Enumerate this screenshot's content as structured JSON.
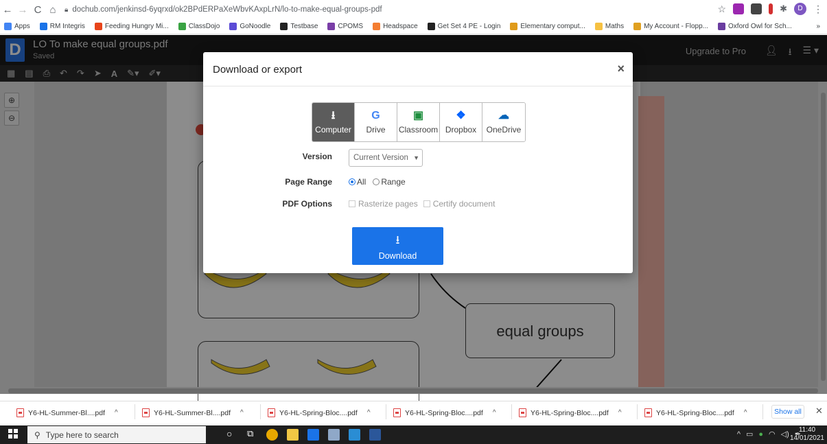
{
  "browser": {
    "url": "dochub.com/jenkinsd-6yqrxd/ok2BPdERPaXeWbvKAxpLrN/lo-to-make-equal-groups-pdf",
    "profile_initial": "D",
    "bookmarks": [
      {
        "label": "Apps",
        "color": "#4285f4"
      },
      {
        "label": "RM Integris",
        "color": "#1a73e8"
      },
      {
        "label": "Feeding Hungry Mi...",
        "color": "#e8441a"
      },
      {
        "label": "ClassDojo",
        "color": "#3aa343"
      },
      {
        "label": "GoNoodle",
        "color": "#5b4bd6"
      },
      {
        "label": "Testbase",
        "color": "#222222"
      },
      {
        "label": "CPOMS",
        "color": "#7a3ea7"
      },
      {
        "label": "Headspace",
        "color": "#f47d31"
      },
      {
        "label": "Get Set 4 PE - Login",
        "color": "#222222"
      },
      {
        "label": "Elementary comput...",
        "color": "#e09b1a"
      },
      {
        "label": "Maths",
        "color": "#f6c142"
      },
      {
        "label": "My Account - Flopp...",
        "color": "#e0a020"
      },
      {
        "label": "Oxford Owl for Sch...",
        "color": "#6a3da0"
      }
    ],
    "bookmarks_overflow": "»"
  },
  "app": {
    "logo": "D",
    "doc_title": "LO To make equal groups.pdf",
    "doc_status": "Saved",
    "upgrade_label": "Upgrade to Pro"
  },
  "document": {
    "label_text": "equal groups"
  },
  "modal": {
    "title": "Download or export",
    "close": "×",
    "destinations": [
      {
        "label": "Computer",
        "glyph": "⭳",
        "icon": "download-icon",
        "color": "#ffffff"
      },
      {
        "label": "Drive",
        "glyph": "G",
        "icon": "google-drive-icon",
        "color": "#4285f4"
      },
      {
        "label": "Classroom",
        "glyph": "▣",
        "icon": "google-classroom-icon",
        "color": "#1e8e3e"
      },
      {
        "label": "Dropbox",
        "glyph": "❖",
        "icon": "dropbox-icon",
        "color": "#0061fe"
      },
      {
        "label": "OneDrive",
        "glyph": "☁",
        "icon": "onedrive-icon",
        "color": "#0364b8"
      }
    ],
    "version_label": "Version",
    "version_value": "Current Version",
    "page_range_label": "Page Range",
    "range_all": "All",
    "range_range": "Range",
    "pdf_options_label": "PDF Options",
    "opt_rasterize": "Rasterize pages",
    "opt_certify": "Certify document",
    "download_label": "Download"
  },
  "downloads": {
    "items": [
      "Y6-HL-Summer-Bl....pdf",
      "Y6-HL-Summer-Bl....pdf",
      "Y6-HL-Spring-Bloc....pdf",
      "Y6-HL-Spring-Bloc....pdf",
      "Y6-HL-Spring-Bloc....pdf",
      "Y6-HL-Spring-Bloc....pdf"
    ],
    "show_all": "Show all"
  },
  "taskbar": {
    "search_placeholder": "Type here to search",
    "time": "11:40",
    "date": "14/01/2021"
  }
}
